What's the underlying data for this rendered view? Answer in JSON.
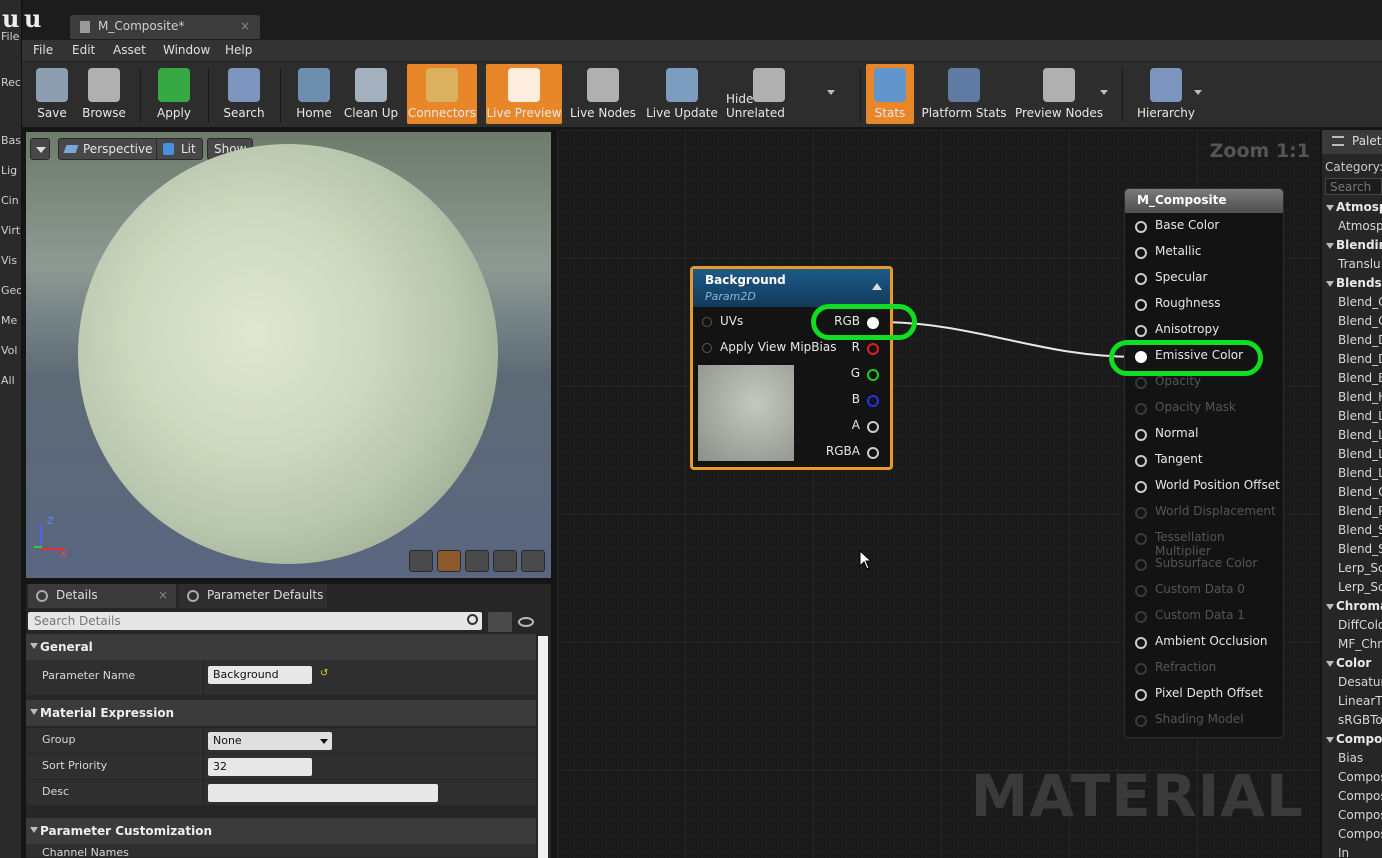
{
  "window": {
    "tab_title": "M_Composite*",
    "close": "×"
  },
  "left_strip": [
    "File",
    "Rec",
    "Bas",
    "Lig",
    "Cin",
    "Virt",
    "Vis",
    "Geo",
    "Me",
    "Vol",
    "All"
  ],
  "menu": [
    "File",
    "Edit",
    "Asset",
    "Window",
    "Help"
  ],
  "toolbar": {
    "items": [
      {
        "label": "Save",
        "icon": "save-icon"
      },
      {
        "label": "Browse",
        "icon": "browse-icon"
      },
      {
        "label": "Apply",
        "icon": "apply-check-icon"
      },
      {
        "label": "Search",
        "icon": "search-binoculars-icon"
      },
      {
        "label": "Home",
        "icon": "home-icon"
      },
      {
        "label": "Clean Up",
        "icon": "broom-icon"
      },
      {
        "label": "Connectors",
        "icon": "connectors-icon",
        "active": true
      },
      {
        "label": "Live Preview",
        "icon": "tv-preview-icon",
        "active": true
      },
      {
        "label": "Live Nodes",
        "icon": "live-nodes-icon"
      },
      {
        "label": "Live Update",
        "icon": "live-update-icon"
      },
      {
        "label": "Hide Unrelated",
        "icon": "hide-unrelated-icon"
      },
      {
        "label": "Stats",
        "icon": "stats-icon",
        "active": true
      },
      {
        "label": "Platform Stats",
        "icon": "platform-stats-icon"
      },
      {
        "label": "Preview Nodes",
        "icon": "preview-nodes-icon"
      },
      {
        "label": "Hierarchy",
        "icon": "hierarchy-icon"
      }
    ],
    "accent": "#e8872a"
  },
  "viewport": {
    "perspective": "Perspective",
    "lit": "Lit",
    "show": "Show",
    "axis_z": "Z",
    "axis_x": "X"
  },
  "details": {
    "tab_details": "Details",
    "tab_params": "Parameter Defaults",
    "search_placeholder": "Search Details",
    "cat_general": "General",
    "param_name_label": "Parameter Name",
    "param_name_value": "Background",
    "cat_material_expression": "Material Expression",
    "group_label": "Group",
    "group_value": "None",
    "sort_priority_label": "Sort Priority",
    "sort_priority_value": "32",
    "desc_label": "Desc",
    "cat_param_custom": "Parameter Customization",
    "channel_names": "Channel Names"
  },
  "graph": {
    "zoom": "Zoom 1:1",
    "watermark": "MATERIAL",
    "bg_node": {
      "title": "Background",
      "subtitle": "Param2D",
      "inputs": [
        "UVs",
        "Apply View MipBias"
      ],
      "outputs": [
        {
          "label": "RGB",
          "color": "#ffffff"
        },
        {
          "label": "R",
          "color": "#e02020"
        },
        {
          "label": "G",
          "color": "#22cc22"
        },
        {
          "label": "B",
          "color": "#2233ee"
        },
        {
          "label": "A",
          "color": "#cccccc"
        },
        {
          "label": "RGBA",
          "color": "#cccccc"
        }
      ]
    },
    "result_node": {
      "title": "M_Composite",
      "pins": [
        {
          "label": "Base Color",
          "enabled": true
        },
        {
          "label": "Metallic",
          "enabled": true
        },
        {
          "label": "Specular",
          "enabled": true
        },
        {
          "label": "Roughness",
          "enabled": true
        },
        {
          "label": "Anisotropy",
          "enabled": true
        },
        {
          "label": "Emissive Color",
          "enabled": true,
          "connected": true
        },
        {
          "label": "Opacity",
          "enabled": false
        },
        {
          "label": "Opacity Mask",
          "enabled": false
        },
        {
          "label": "Normal",
          "enabled": true
        },
        {
          "label": "Tangent",
          "enabled": true
        },
        {
          "label": "World Position Offset",
          "enabled": true
        },
        {
          "label": "World Displacement",
          "enabled": false
        },
        {
          "label": "Tessellation Multiplier",
          "enabled": false
        },
        {
          "label": "Subsurface Color",
          "enabled": false
        },
        {
          "label": "Custom Data 0",
          "enabled": false
        },
        {
          "label": "Custom Data 1",
          "enabled": false
        },
        {
          "label": "Ambient Occlusion",
          "enabled": true
        },
        {
          "label": "Refraction",
          "enabled": false
        },
        {
          "label": "Pixel Depth Offset",
          "enabled": true
        },
        {
          "label": "Shading Model",
          "enabled": false
        }
      ]
    },
    "highlight_color": "#11dd22"
  },
  "palette": {
    "title": "Palett",
    "category_label": "Category:",
    "search_placeholder": "Search",
    "entries": [
      {
        "t": "cat",
        "label": "Atmosph"
      },
      {
        "t": "item",
        "label": "Atmosp"
      },
      {
        "t": "cat",
        "label": "Blending"
      },
      {
        "t": "item",
        "label": "Translu"
      },
      {
        "t": "cat",
        "label": "Blends"
      },
      {
        "t": "item",
        "label": "Blend_C"
      },
      {
        "t": "item",
        "label": "Blend_C"
      },
      {
        "t": "item",
        "label": "Blend_D"
      },
      {
        "t": "item",
        "label": "Blend_D"
      },
      {
        "t": "item",
        "label": "Blend_E"
      },
      {
        "t": "item",
        "label": "Blend_H"
      },
      {
        "t": "item",
        "label": "Blend_L"
      },
      {
        "t": "item",
        "label": "Blend_L"
      },
      {
        "t": "item",
        "label": "Blend_L"
      },
      {
        "t": "item",
        "label": "Blend_L"
      },
      {
        "t": "item",
        "label": "Blend_C"
      },
      {
        "t": "item",
        "label": "Blend_P"
      },
      {
        "t": "item",
        "label": "Blend_S"
      },
      {
        "t": "item",
        "label": "Blend_S"
      },
      {
        "t": "item",
        "label": "Lerp_Sc"
      },
      {
        "t": "item",
        "label": "Lerp_Sc"
      },
      {
        "t": "cat",
        "label": "Chromak"
      },
      {
        "t": "item",
        "label": "DiffColo"
      },
      {
        "t": "item",
        "label": "MF_Chr"
      },
      {
        "t": "cat",
        "label": "Color"
      },
      {
        "t": "item",
        "label": "Desatur"
      },
      {
        "t": "item",
        "label": "LinearT"
      },
      {
        "t": "item",
        "label": "sRGBTo"
      },
      {
        "t": "cat",
        "label": "Compos"
      },
      {
        "t": "item",
        "label": "Bias"
      },
      {
        "t": "item",
        "label": "Compos"
      },
      {
        "t": "item",
        "label": "Compos"
      },
      {
        "t": "item",
        "label": "Compos"
      },
      {
        "t": "item",
        "label": "Compos"
      },
      {
        "t": "item",
        "label": "In"
      }
    ]
  }
}
